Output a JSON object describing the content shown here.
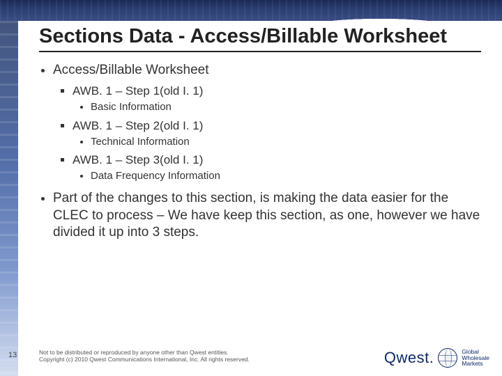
{
  "title": "Sections Data - Access/Billable Worksheet",
  "bullets": {
    "main1": "Access/Billable Worksheet",
    "step1": "AWB. 1 – Step 1(old I. 1)",
    "step1_sub": "Basic Information",
    "step2": "AWB. 1 – Step 2(old I. 1)",
    "step2_sub": "Technical Information",
    "step3": "AWB. 1 – Step 3(old I. 1)",
    "step3_sub": "Data Frequency Information",
    "main2": "Part of the changes to this section, is making the data easier for the CLEC to process – We have keep this section, as one, however we have divided it up into 3 steps."
  },
  "footer": {
    "page": "13",
    "legal1": "Not to be distributed or reproduced by anyone other than Qwest entities.",
    "legal2": "Copyright (c) 2010 Qwest Communications International, Inc.  All rights reserved."
  },
  "logo": {
    "brand": "Qwest",
    "tag1": "Global",
    "tag2": "Wholesale",
    "tag3": "Markets"
  }
}
